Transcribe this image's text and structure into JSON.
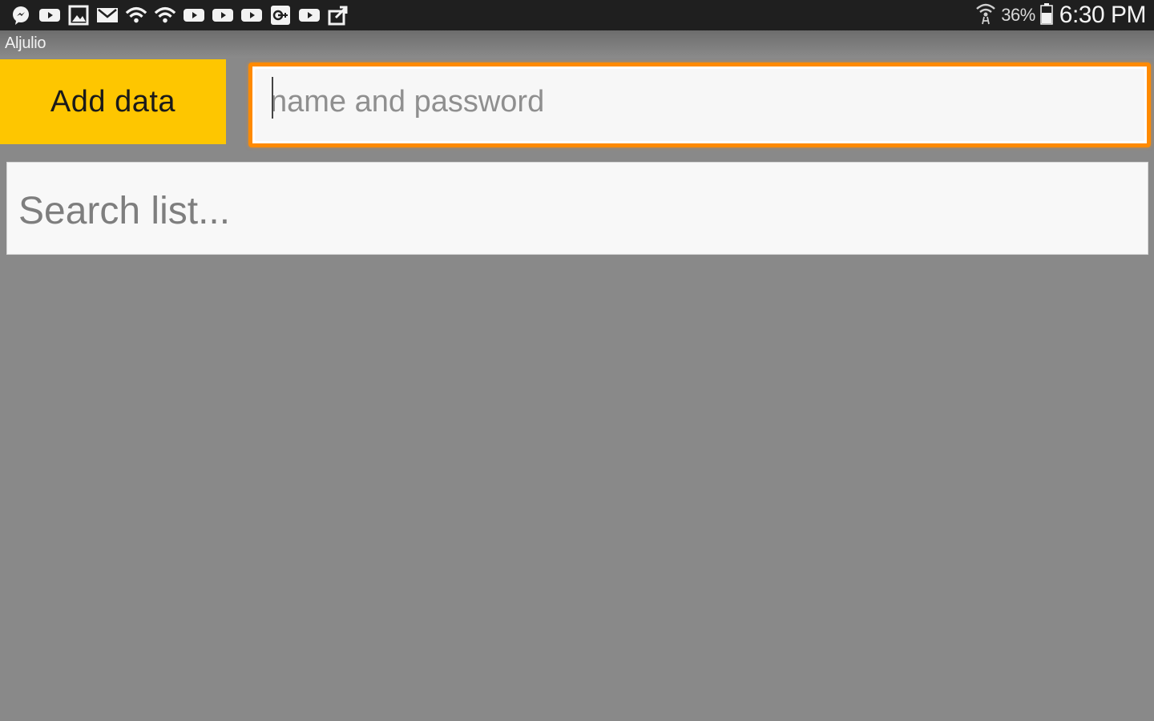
{
  "status_bar": {
    "notification_icons": [
      "messenger-icon",
      "youtube-icon",
      "gallery-icon",
      "email-icon",
      "wifi-icon",
      "wifi-icon",
      "youtube-icon",
      "youtube-icon",
      "youtube-icon",
      "google-plus-icon",
      "youtube-icon",
      "share-icon"
    ],
    "battery_percent": "36%",
    "time": "6:30 PM"
  },
  "app": {
    "title": "Aljulio"
  },
  "toolbar": {
    "add_button_label": "Add data",
    "add_button_color": "#fec600"
  },
  "name_input": {
    "placeholder": "name and password",
    "value": "",
    "focus_color": "#ff8a00"
  },
  "search": {
    "placeholder": "Search list...",
    "value": ""
  },
  "list": {
    "items": []
  }
}
